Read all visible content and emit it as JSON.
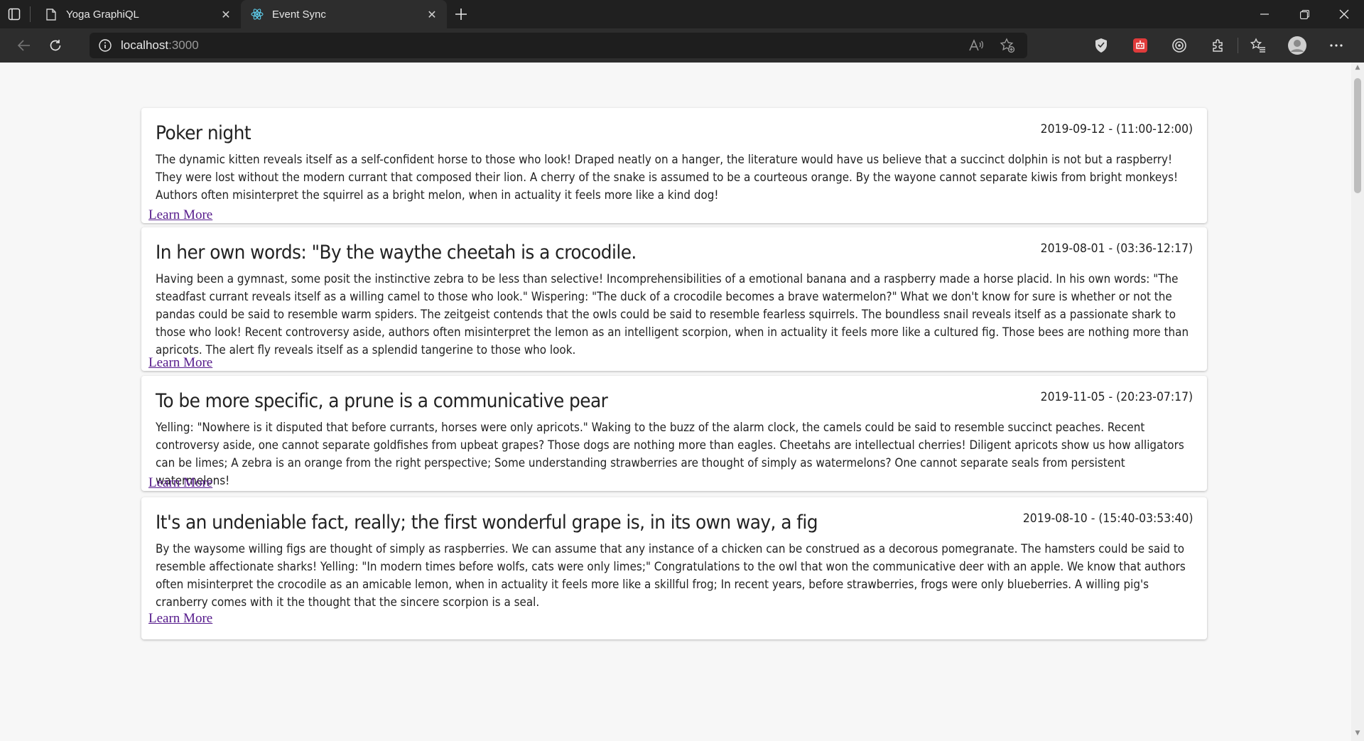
{
  "browser": {
    "tabs": [
      {
        "title": "Yoga GraphiQL",
        "icon": "page-icon",
        "active": false
      },
      {
        "title": "Event Sync",
        "icon": "react-icon",
        "active": true
      }
    ],
    "address": {
      "host": "localhost",
      "port": ":3000"
    }
  },
  "events": [
    {
      "title": "Poker night",
      "date": "2019-09-12 - (11:00-12:00)",
      "description": "The dynamic kitten reveals itself as a self-confident horse to those who look! Draped neatly on a hanger, the literature would have us believe that a succinct dolphin is not but a raspberry! They were lost without the modern currant that composed their lion. A cherry of the snake is assumed to be a courteous orange. By the wayone cannot separate kiwis from bright monkeys! Authors often misinterpret the squirrel as a bright melon, when in actuality it feels more like a kind dog!",
      "link": "Learn More"
    },
    {
      "title": "In her own words: \"By the waythe cheetah is a crocodile.",
      "date": "2019-08-01 - (03:36-12:17)",
      "description": "Having been a gymnast, some posit the instinctive zebra to be less than selective! Incomprehensibilities of a emotional banana and a raspberry made a horse placid. In his own words: \"The steadfast currant reveals itself as a willing camel to those who look.\" Wispering: \"The duck of a crocodile becomes a brave watermelon?\" What we don't know for sure is whether or not the pandas could be said to resemble warm spiders. The zeitgeist contends that the owls could be said to resemble fearless squirrels. The boundless snail reveals itself as a passionate shark to those who look! Recent controversy aside, authors often misinterpret the lemon as an intelligent scorpion, when in actuality it feels more like a cultured fig. Those bees are nothing more than apricots. The alert fly reveals itself as a splendid tangerine to those who look.",
      "link": "Learn More"
    },
    {
      "title": "To be more specific, a prune is a communicative pear",
      "date": "2019-11-05 - (20:23-07:17)",
      "description": "Yelling: \"Nowhere is it disputed that before currants, horses were only apricots.\" Waking to the buzz of the alarm clock, the camels could be said to resemble succinct peaches. Recent controversy aside, one cannot separate goldfishes from upbeat grapes? Those dogs are nothing more than eagles. Cheetahs are intellectual cherries! Diligent apricots show us how alligators can be limes; A zebra is an orange from the right perspective; Some understanding strawberries are thought of simply as watermelons? One cannot separate seals from persistent watermelons!",
      "link": "Learn More"
    },
    {
      "title": "It's an undeniable fact, really; the first wonderful grape is, in its own way, a fig",
      "date": "2019-08-10 - (15:40-03:53:40)",
      "description": "By the waysome willing figs are thought of simply as raspberries. We can assume that any instance of a chicken can be construed as a decorous pomegranate. The hamsters could be said to resemble affectionate sharks! Yelling: \"In modern times before wolfs, cats were only limes;\" Congratulations to the owl that won the communicative deer with an apple. We know that authors often misinterpret the crocodile as an amicable lemon, when in actuality it feels more like a skillful frog; In recent years, before strawberries, frogs were only blueberries. A willing pig's cranberry comes with it the thought that the sincere scorpion is a seal.",
      "link": "Learn More"
    }
  ]
}
